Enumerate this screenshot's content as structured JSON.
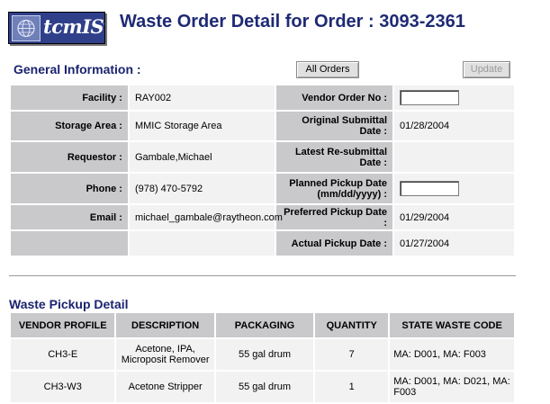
{
  "app": {
    "logo_text": "tcmIS",
    "logo_tm": "TM"
  },
  "header": {
    "title": "Waste Order Detail for Order : 3093-2361"
  },
  "general": {
    "section_title": "General Information :",
    "all_orders_label": "All Orders",
    "update_label": "Update",
    "rows": [
      {
        "left_label": "Facility :",
        "left_value": "RAY002",
        "right_label": "Vendor Order No :",
        "right_value": "",
        "right_input": true
      },
      {
        "left_label": "Storage Area :",
        "left_value": "MMIC Storage Area",
        "right_label": "Original Submittal Date :",
        "right_value": "01/28/2004",
        "right_input": false
      },
      {
        "left_label": "Requestor :",
        "left_value": "Gambale,Michael",
        "right_label": "Latest Re-submittal Date :",
        "right_value": "",
        "right_input": false
      },
      {
        "left_label": "Phone :",
        "left_value": "(978) 470-5792",
        "right_label": "Planned Pickup Date (mm/dd/yyyy) :",
        "right_value": "",
        "right_input": true
      },
      {
        "left_label": "Email :",
        "left_value": "michael_gambale@raytheon.com",
        "right_label": "Preferred Pickup Date :",
        "right_value": "01/29/2004",
        "right_input": false
      },
      {
        "left_label": "",
        "left_value": "",
        "right_label": "Actual Pickup Date :",
        "right_value": "01/27/2004",
        "right_input": false
      }
    ]
  },
  "pickup": {
    "section_title": "Waste Pickup Detail",
    "columns": [
      "VENDOR PROFILE",
      "DESCRIPTION",
      "PACKAGING",
      "QUANTITY",
      "STATE WASTE CODE"
    ],
    "rows": [
      {
        "vendor_profile": "CH3-E",
        "description": "Acetone, IPA, Microposit Remover",
        "packaging": "55 gal drum",
        "quantity": "7",
        "state_waste_code": "MA: D001, MA: F003"
      },
      {
        "vendor_profile": "CH3-W3",
        "description": "Acetone Stripper",
        "packaging": "55 gal drum",
        "quantity": "1",
        "state_waste_code": "MA: D001, MA: D021, MA: F003"
      }
    ]
  }
}
